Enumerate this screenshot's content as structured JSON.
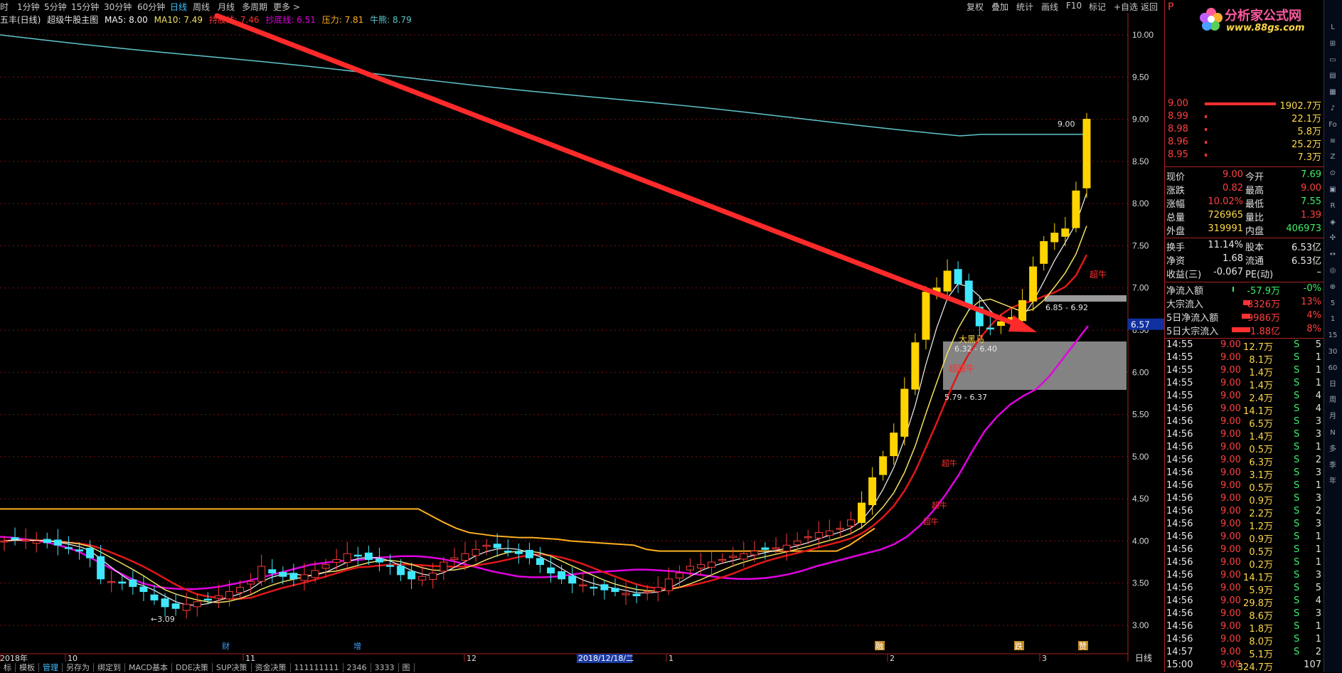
{
  "toolbar": {
    "periods": [
      "时",
      "1分钟",
      "5分钟",
      "15分钟",
      "30分钟",
      "60分钟",
      "日线",
      "周线",
      "月线",
      "多周期",
      "更多 >"
    ],
    "active": "日线",
    "right": [
      "复权",
      "叠加",
      "统计",
      "画线",
      "F10",
      "标记",
      "+自选",
      "返回"
    ]
  },
  "info": {
    "title": "五丰(日线)",
    "indicator": "超级牛股主图",
    "ma5": "MA5: 8.00",
    "ma10": "MA10: 7.49",
    "hold": "持股线: 7.46",
    "bottom": "抄底线: 6.51",
    "pressure": "压力: 7.81",
    "bull": "牛熊: 8.79"
  },
  "colors": {
    "up": "#ff3a3a",
    "down": "#3fe8ff",
    "ma_pink": "#e000e0",
    "ma_red": "#e01818",
    "ma_yellow": "#f0e060",
    "ma_white": "#f4f4f4",
    "orange": "#ffb020",
    "teal": "#5fc6cc",
    "arrow": "#ff3030"
  },
  "axis": {
    "ticks": [
      "10.00",
      "9.50",
      "9.00",
      "8.50",
      "8.00",
      "7.50",
      "7.00",
      "6.50",
      "6.00",
      "5.50",
      "5.00",
      "4.50",
      "4.00",
      "3.50",
      "3.00"
    ],
    "current_price_tag": "6.57",
    "period_label": "日线"
  },
  "dates": {
    "labels": [
      "2018年",
      "10",
      "11",
      "12",
      "1",
      "2",
      "3"
    ],
    "highlight": "2018/12/18/二"
  },
  "annotations": {
    "low": "3.09",
    "high": "9.00",
    "zone_upper": "6.85 - 6.92",
    "zone_mid": "6.32 - 6.40",
    "zone_lower": "5.79 - 6.37",
    "chaoniu": "超牛",
    "damajia": "大黑马",
    "chaoji": "超超牛"
  },
  "events": [
    "财",
    "增",
    "融",
    "跌",
    "赞"
  ],
  "bottom_tabs": [
    "标",
    "模板",
    "管理",
    "另存为",
    "绑定到",
    "MACD基本",
    "DDE决策",
    "SUP决策",
    "资金决策",
    "111111111",
    "2346",
    "3333",
    "图"
  ],
  "active_tab": "管理",
  "watermark": {
    "name": "分析家公式网",
    "url": "www.88gs.com"
  },
  "quote": {
    "tag": "P",
    "asks": [
      {
        "price": "9.00",
        "vol": "1902.7万"
      },
      {
        "price": "8.99",
        "vol": "22.1万"
      },
      {
        "price": "8.98",
        "vol": "5.8万"
      },
      {
        "price": "8.96",
        "vol": "25.2万"
      },
      {
        "price": "8.95",
        "vol": "7.3万"
      }
    ],
    "stats": [
      [
        "现价",
        "9.00",
        "今开",
        "7.69"
      ],
      [
        "涨跌",
        "0.82",
        "最高",
        "9.00"
      ],
      [
        "涨幅",
        "10.02%",
        "最低",
        "7.55"
      ],
      [
        "总量",
        "726965",
        "量比",
        "1.39"
      ],
      [
        "外盘",
        "319991",
        "内盘",
        "406973"
      ]
    ],
    "fund": [
      [
        "换手",
        "11.14%",
        "股本",
        "6.53亿"
      ],
      [
        "净资",
        "1.68",
        "流通",
        "6.53亿"
      ],
      [
        "收益(三)",
        "-0.067",
        "PE(动)",
        "–"
      ]
    ],
    "flows": [
      [
        "净流入额",
        "-57.9万",
        "-0%"
      ],
      [
        "大宗流入",
        "8326万",
        "13%"
      ],
      [
        "5日净流入额",
        "9986万",
        "4%"
      ],
      [
        "5日大宗流入",
        "1.88亿",
        "8%"
      ]
    ],
    "ticks": [
      [
        "14:55",
        "9.00",
        "12.7万",
        "S",
        "5"
      ],
      [
        "14:55",
        "9.00",
        "8.1万",
        "S",
        "1"
      ],
      [
        "14:55",
        "9.00",
        "1.4万",
        "S",
        "1"
      ],
      [
        "14:55",
        "9.00",
        "1.4万",
        "S",
        "1"
      ],
      [
        "14:55",
        "9.00",
        "2.4万",
        "S",
        "4"
      ],
      [
        "14:56",
        "9.00",
        "14.1万",
        "S",
        "4"
      ],
      [
        "14:56",
        "9.00",
        "6.5万",
        "S",
        "3"
      ],
      [
        "14:56",
        "9.00",
        "1.4万",
        "S",
        "3"
      ],
      [
        "14:56",
        "9.00",
        "0.5万",
        "S",
        "1"
      ],
      [
        "14:56",
        "9.00",
        "6.3万",
        "S",
        "2"
      ],
      [
        "14:56",
        "9.00",
        "3.1万",
        "S",
        "3"
      ],
      [
        "14:56",
        "9.00",
        "0.5万",
        "S",
        "1"
      ],
      [
        "14:56",
        "9.00",
        "0.9万",
        "S",
        "3"
      ],
      [
        "14:56",
        "9.00",
        "2.2万",
        "S",
        "2"
      ],
      [
        "14:56",
        "9.00",
        "1.2万",
        "S",
        "3"
      ],
      [
        "14:56",
        "9.00",
        "0.9万",
        "S",
        "1"
      ],
      [
        "14:56",
        "9.00",
        "0.5万",
        "S",
        "1"
      ],
      [
        "14:56",
        "9.00",
        "0.2万",
        "S",
        "1"
      ],
      [
        "14:56",
        "9.00",
        "14.1万",
        "S",
        "3"
      ],
      [
        "14:56",
        "9.00",
        "5.9万",
        "S",
        "5"
      ],
      [
        "14:56",
        "9.00",
        "29.8万",
        "S",
        "4"
      ],
      [
        "14:56",
        "9.00",
        "8.6万",
        "S",
        "3"
      ],
      [
        "14:56",
        "9.00",
        "1.8万",
        "S",
        "1"
      ],
      [
        "14:56",
        "9.00",
        "8.0万",
        "S",
        "1"
      ],
      [
        "14:57",
        "9.00",
        "5.1万",
        "S",
        "2"
      ],
      [
        "15:00",
        "9.00",
        "324.7万",
        "",
        "107"
      ]
    ]
  },
  "side_icons": [
    "L",
    "⊞",
    "▭",
    "▤",
    "▦",
    "♪",
    "Fo",
    "≋",
    "Z",
    "⊙",
    "▣",
    "R",
    "◈",
    "✣",
    "↔",
    "◎",
    "⊕",
    "5",
    "1",
    "15",
    "30",
    "60",
    "日",
    "周",
    "月",
    "N",
    "多",
    "季",
    "年"
  ],
  "chart_data": {
    "type": "candlestick",
    "ylim": [
      2.75,
      10.25
    ],
    "closes": [
      4.0,
      4.02,
      4.01,
      4.0,
      3.98,
      3.95,
      3.92,
      3.88,
      3.8,
      3.55,
      3.52,
      3.5,
      3.46,
      3.4,
      3.3,
      3.22,
      3.2,
      3.25,
      3.28,
      3.3,
      3.35,
      3.4,
      3.45,
      3.52,
      3.7,
      3.62,
      3.58,
      3.55,
      3.6,
      3.65,
      3.72,
      3.78,
      3.85,
      3.82,
      3.78,
      3.75,
      3.7,
      3.6,
      3.55,
      3.58,
      3.62,
      3.75,
      3.8,
      3.85,
      3.9,
      3.95,
      3.92,
      3.88,
      3.85,
      3.8,
      3.72,
      3.62,
      3.55,
      3.5,
      3.48,
      3.45,
      3.42,
      3.4,
      3.38,
      3.35,
      3.4,
      3.45,
      3.55,
      3.62,
      3.7,
      3.72,
      3.75,
      3.78,
      3.82,
      3.85,
      3.88,
      3.9,
      3.92,
      3.95,
      4.0,
      4.05,
      4.1,
      4.12,
      4.15,
      4.25,
      4.45,
      4.75,
      5.0,
      5.28,
      5.8,
      6.35,
      6.95,
      7.0,
      7.2,
      7.05,
      6.8,
      6.55,
      6.52,
      6.6,
      6.65,
      6.85,
      7.25,
      7.55,
      7.65,
      7.7,
      8.15,
      9.0
    ],
    "ma_pink": [
      4.05,
      4.04,
      4.02,
      4.0,
      3.97,
      3.93,
      3.88,
      3.8,
      3.72,
      3.64,
      3.56,
      3.5,
      3.46,
      3.44,
      3.43,
      3.43,
      3.44,
      3.46,
      3.49,
      3.52,
      3.56,
      3.6,
      3.64,
      3.68,
      3.72,
      3.74,
      3.76,
      3.77,
      3.78,
      3.8,
      3.81,
      3.82,
      3.82,
      3.81,
      3.79,
      3.76,
      3.72,
      3.68,
      3.64,
      3.61,
      3.58,
      3.57,
      3.57,
      3.58,
      3.6,
      3.62,
      3.63,
      3.64,
      3.65,
      3.66,
      3.66,
      3.65,
      3.64,
      3.62,
      3.6,
      3.58,
      3.56,
      3.55,
      3.55,
      3.56,
      3.58,
      3.61,
      3.65,
      3.7,
      3.74,
      3.78,
      3.82,
      3.86,
      3.9,
      3.96,
      4.05,
      4.18,
      4.35,
      4.55,
      4.78,
      5.05,
      5.3,
      5.48,
      5.62,
      5.72,
      5.8,
      5.95,
      6.15,
      6.35,
      6.55
    ],
    "bull_flat": [
      4.38,
      4.38,
      4.38,
      4.38,
      4.38,
      4.38,
      4.38,
      4.38,
      4.38,
      4.38,
      4.38,
      4.38,
      4.38,
      4.38,
      4.38,
      4.38,
      4.38,
      4.38,
      4.38,
      4.38,
      4.38,
      4.38,
      4.38,
      4.38,
      4.38,
      4.38,
      4.38,
      4.38,
      4.38,
      4.38,
      4.38,
      4.38,
      4.38,
      4.38,
      4.3,
      4.22,
      4.15,
      4.1,
      4.08,
      4.06,
      4.05,
      4.04,
      4.04,
      4.03,
      4.02,
      4.0,
      3.99,
      3.98,
      3.97,
      3.96,
      3.95,
      3.9,
      3.88,
      3.88,
      3.88,
      3.88,
      3.88,
      3.88,
      3.88,
      3.88,
      3.88,
      3.88,
      3.88,
      3.88,
      3.88,
      3.88,
      3.88,
      3.95,
      4.05,
      4.15
    ]
  }
}
